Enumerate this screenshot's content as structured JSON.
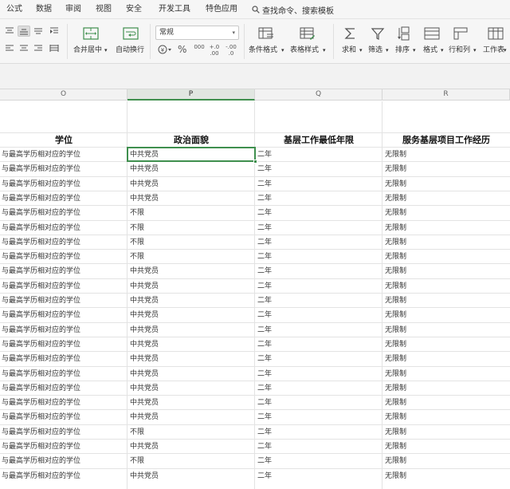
{
  "menu": {
    "items": [
      "公式",
      "数据",
      "审阅",
      "视图",
      "安全",
      "开发工具",
      "特色应用"
    ],
    "search_text": "查找命令、搜索模板"
  },
  "ribbon": {
    "merge_label": "合并居中",
    "wrap_label": "自动换行",
    "number_format": "常规",
    "cond_format_label": "条件格式",
    "table_style_label": "表格样式",
    "sum_label": "求和",
    "filter_label": "筛选",
    "sort_label": "排序",
    "format_label": "格式",
    "rowcol_label": "行和列",
    "worksheet_label": "工作表",
    "dropdown_arrow": "▾",
    "percent_symbol": "%",
    "thousands_symbol": "000",
    "dec_increase": "+.0\n.00",
    "dec_decrease": "-.00\n.0"
  },
  "columns": [
    "O",
    "P",
    "Q",
    "R"
  ],
  "headers": [
    "学位",
    "政治面貌",
    "基层工作最低年限",
    "服务基层项目工作经历"
  ],
  "rows": [
    [
      "与最高学历相对应的学位",
      "中共党员",
      "二年",
      "无限制"
    ],
    [
      "与最高学历相对应的学位",
      "中共党员",
      "二年",
      "无限制"
    ],
    [
      "与最高学历相对应的学位",
      "中共党员",
      "二年",
      "无限制"
    ],
    [
      "与最高学历相对应的学位",
      "中共党员",
      "二年",
      "无限制"
    ],
    [
      "与最高学历相对应的学位",
      "不限",
      "二年",
      "无限制"
    ],
    [
      "与最高学历相对应的学位",
      "不限",
      "二年",
      "无限制"
    ],
    [
      "与最高学历相对应的学位",
      "不限",
      "二年",
      "无限制"
    ],
    [
      "与最高学历相对应的学位",
      "不限",
      "二年",
      "无限制"
    ],
    [
      "与最高学历相对应的学位",
      "中共党员",
      "二年",
      "无限制"
    ],
    [
      "与最高学历相对应的学位",
      "中共党员",
      "二年",
      "无限制"
    ],
    [
      "与最高学历相对应的学位",
      "中共党员",
      "二年",
      "无限制"
    ],
    [
      "与最高学历相对应的学位",
      "中共党员",
      "二年",
      "无限制"
    ],
    [
      "与最高学历相对应的学位",
      "中共党员",
      "二年",
      "无限制"
    ],
    [
      "与最高学历相对应的学位",
      "中共党员",
      "二年",
      "无限制"
    ],
    [
      "与最高学历相对应的学位",
      "中共党员",
      "二年",
      "无限制"
    ],
    [
      "与最高学历相对应的学位",
      "中共党员",
      "二年",
      "无限制"
    ],
    [
      "与最高学历相对应的学位",
      "中共党员",
      "二年",
      "无限制"
    ],
    [
      "与最高学历相对应的学位",
      "中共党员",
      "二年",
      "无限制"
    ],
    [
      "与最高学历相对应的学位",
      "中共党员",
      "二年",
      "无限制"
    ],
    [
      "与最高学历相对应的学位",
      "不限",
      "二年",
      "无限制"
    ],
    [
      "与最高学历相对应的学位",
      "中共党员",
      "二年",
      "无限制"
    ],
    [
      "与最高学历相对应的学位",
      "不限",
      "二年",
      "无限制"
    ],
    [
      "与最高学历相对应的学位",
      "中共党员",
      "二年",
      "无限制"
    ]
  ],
  "colors": {
    "accent_green": "#3f8f4e",
    "icon_gray": "#555555"
  }
}
